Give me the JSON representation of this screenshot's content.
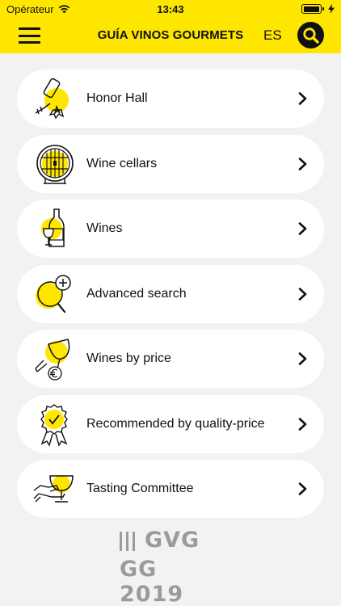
{
  "status": {
    "carrier": "Opérateur",
    "time": "13:43",
    "battery_level": 0.95
  },
  "nav": {
    "title": "GUÍA VINOS GOURMETS",
    "language": "ES"
  },
  "menu": {
    "items": [
      {
        "label": "Honor Hall",
        "icon": "corkscrew-award-icon"
      },
      {
        "label": "Wine cellars",
        "icon": "barrel-icon"
      },
      {
        "label": "Wines",
        "icon": "wine-bottle-glass-icon"
      },
      {
        "label": "Advanced search",
        "icon": "magnifier-plus-icon"
      },
      {
        "label": "Wines by price",
        "icon": "glass-euro-icon"
      },
      {
        "label": "Recommended by quality-price",
        "icon": "ribbon-medal-icon"
      },
      {
        "label": "Tasting Committee",
        "icon": "hand-glass-icon"
      }
    ]
  },
  "logo": {
    "top_text": "GVG",
    "bottom_text": "GG 2019"
  },
  "colors": {
    "accent": "#ffe600",
    "background": "#f2f2f2",
    "card": "#ffffff",
    "text": "#111111",
    "logo": "#9b9b9b"
  }
}
